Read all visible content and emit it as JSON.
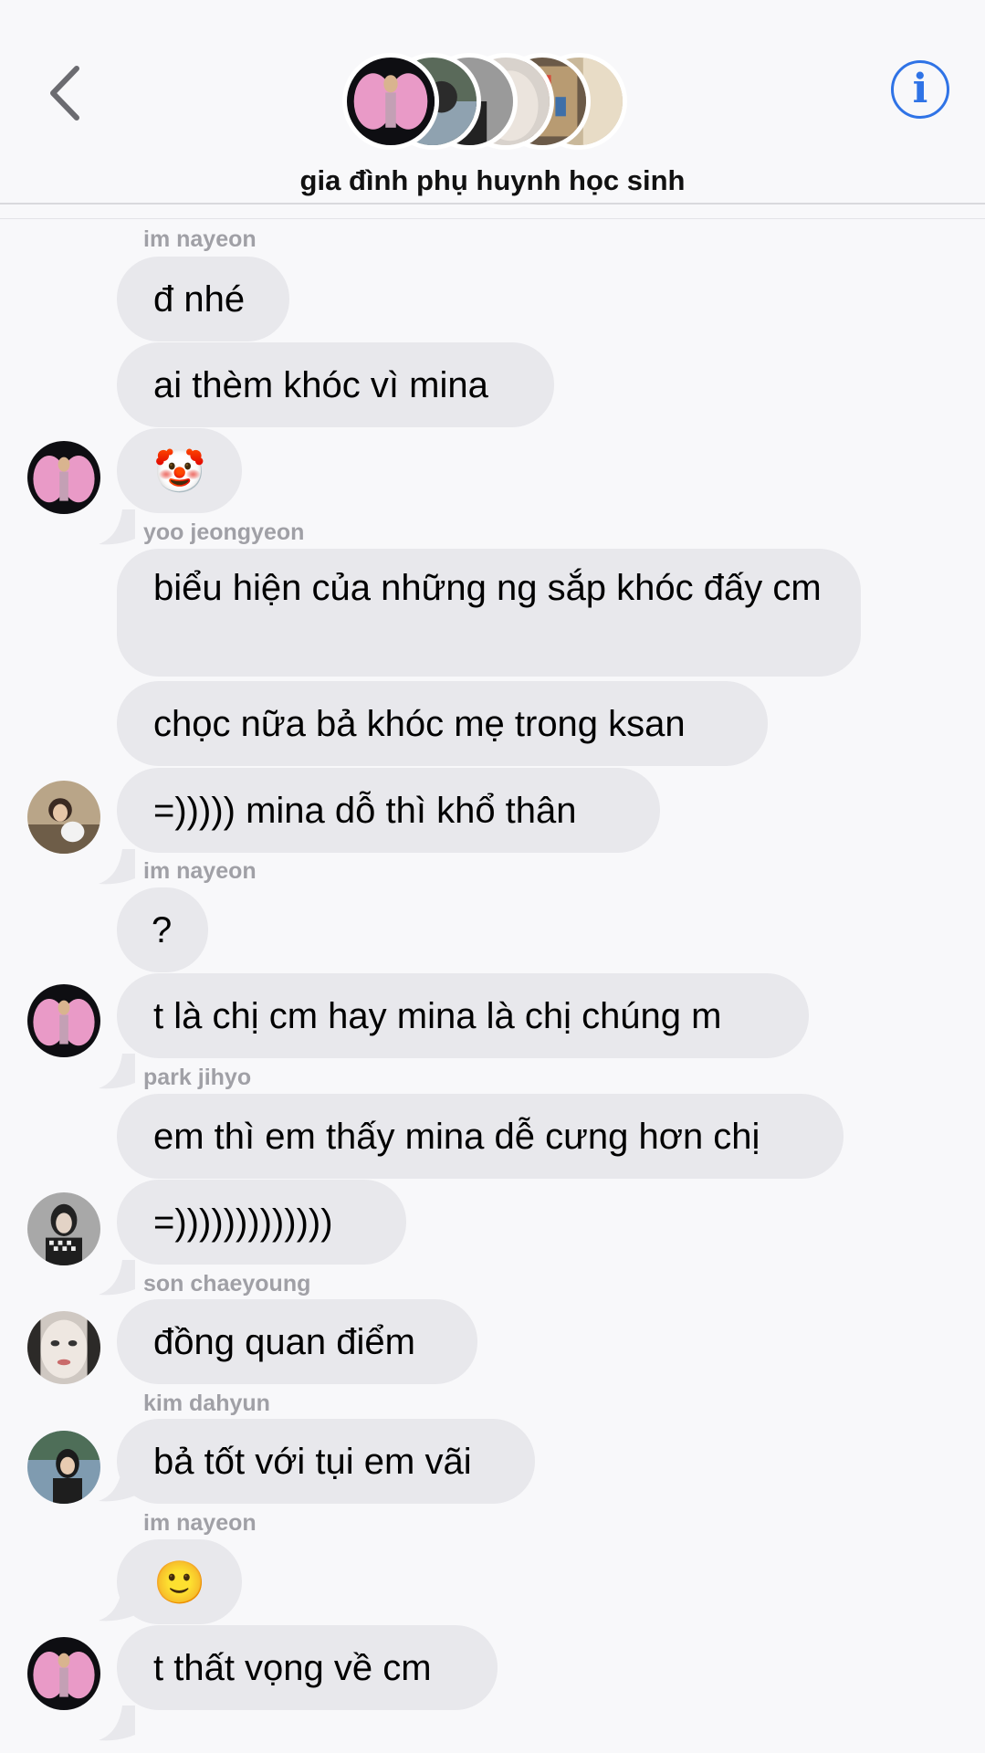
{
  "header": {
    "group_name": "gia đình phụ huynh học sinh"
  },
  "messages": [
    {
      "sender": "im nayeon",
      "texts": [
        "đ nhé",
        "ai thèm khóc vì mina",
        "🤡"
      ]
    },
    {
      "sender": "yoo jeongyeon",
      "texts": [
        "biểu hiện của những ng sắp khóc đấy cm",
        "chọc nữa bả khóc mẹ trong ksan",
        "=))))) mina dỗ thì khổ thân"
      ]
    },
    {
      "sender": "im nayeon",
      "texts": [
        "?",
        "t là chị cm hay mina là chị chúng m"
      ]
    },
    {
      "sender": "park jihyo",
      "texts": [
        "em thì em thấy mina dễ cưng hơn chị",
        "=)))))))))))))"
      ]
    },
    {
      "sender": "son chaeyoung",
      "texts": [
        "đồng quan điểm"
      ]
    },
    {
      "sender": "kim dahyun",
      "texts": [
        "bả tốt với tụi em vãi"
      ]
    },
    {
      "sender": "im nayeon",
      "texts": [
        "🙂",
        "t thất vọng về cm"
      ]
    }
  ],
  "colors": {
    "background": "#f8f8fa",
    "bubble": "#e8e8ec",
    "sender_label": "#a0a0a6",
    "accent": "#2f73e6",
    "back_chevron": "#6b6b70"
  },
  "icons": {
    "back": "chevron-left-icon",
    "info": "info-icon"
  }
}
